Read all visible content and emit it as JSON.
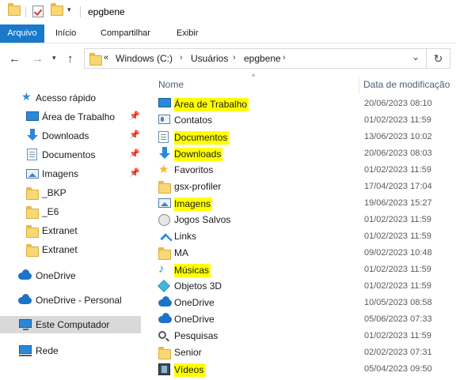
{
  "window": {
    "title": "epgbene"
  },
  "ribbon": {
    "tabs": [
      "Arquivo",
      "Início",
      "Compartilhar",
      "Exibir"
    ]
  },
  "address": {
    "overflow": "«",
    "crumbs": [
      "Windows (C:)",
      "Usuários",
      "epgbene"
    ],
    "separator": "›"
  },
  "nav": {
    "quick_access": "Acesso rápido",
    "items": [
      {
        "label": "Área de Trabalho",
        "icon": "desktop-icon",
        "pinned": true
      },
      {
        "label": "Downloads",
        "icon": "download-icon",
        "pinned": true
      },
      {
        "label": "Documentos",
        "icon": "document-icon",
        "pinned": true
      },
      {
        "label": "Imagens",
        "icon": "image-icon",
        "pinned": true
      },
      {
        "label": "_BKP",
        "icon": "folder-icon",
        "pinned": false
      },
      {
        "label": "_E6",
        "icon": "folder-icon",
        "pinned": false
      },
      {
        "label": "Extranet",
        "icon": "folder-icon",
        "pinned": false
      },
      {
        "label": "Extranet",
        "icon": "folder-icon",
        "pinned": false
      }
    ],
    "onedrive": "OneDrive",
    "onedrive_personal": "OneDrive - Personal",
    "this_pc": "Este Computador",
    "network": "Rede"
  },
  "columns": {
    "name": "Nome",
    "modified": "Data de modificação"
  },
  "files": [
    {
      "name": "Área de Trabalho",
      "date": "20/06/2023 08:10",
      "icon": "desktop-icon",
      "highlighted": true
    },
    {
      "name": "Contatos",
      "date": "01/02/2023 11:59",
      "icon": "contact-icon",
      "highlighted": false
    },
    {
      "name": "Documentos",
      "date": "13/06/2023 10:02",
      "icon": "document-icon",
      "highlighted": true
    },
    {
      "name": "Downloads",
      "date": "20/06/2023 08:03",
      "icon": "download-icon",
      "highlighted": true
    },
    {
      "name": "Favoritos",
      "date": "01/02/2023 11:59",
      "icon": "star-icon",
      "highlighted": false
    },
    {
      "name": "gsx-profiler",
      "date": "17/04/2023 17:04",
      "icon": "folder-icon",
      "highlighted": false
    },
    {
      "name": "Imagens",
      "date": "19/06/2023 15:27",
      "icon": "image-icon",
      "highlighted": true
    },
    {
      "name": "Jogos Salvos",
      "date": "01/02/2023 11:59",
      "icon": "game-icon",
      "highlighted": false
    },
    {
      "name": "Links",
      "date": "01/02/2023 11:59",
      "icon": "link-icon",
      "highlighted": false
    },
    {
      "name": "MA",
      "date": "09/02/2023 10:48",
      "icon": "folder-icon",
      "highlighted": false
    },
    {
      "name": "Músicas",
      "date": "01/02/2023 11:59",
      "icon": "music-icon",
      "highlighted": true
    },
    {
      "name": "Objetos 3D",
      "date": "01/02/2023 11:59",
      "icon": "3d-objects-icon",
      "highlighted": false
    },
    {
      "name": "OneDrive",
      "date": "10/05/2023 08:58",
      "icon": "cloud-icon",
      "highlighted": false
    },
    {
      "name": "OneDrive",
      "date": "05/06/2023 07:33",
      "icon": "cloud-icon",
      "highlighted": false
    },
    {
      "name": "Pesquisas",
      "date": "01/02/2023 11:59",
      "icon": "search-icon",
      "highlighted": false
    },
    {
      "name": "Senior",
      "date": "02/02/2023 07:31",
      "icon": "folder-icon",
      "highlighted": false
    },
    {
      "name": "Vídeos",
      "date": "05/04/2023 09:50",
      "icon": "video-icon",
      "highlighted": true
    }
  ],
  "colors": {
    "file_tab": "#1979ca",
    "highlight": "#ffff00",
    "selected_nav": "#d9d9d9"
  }
}
